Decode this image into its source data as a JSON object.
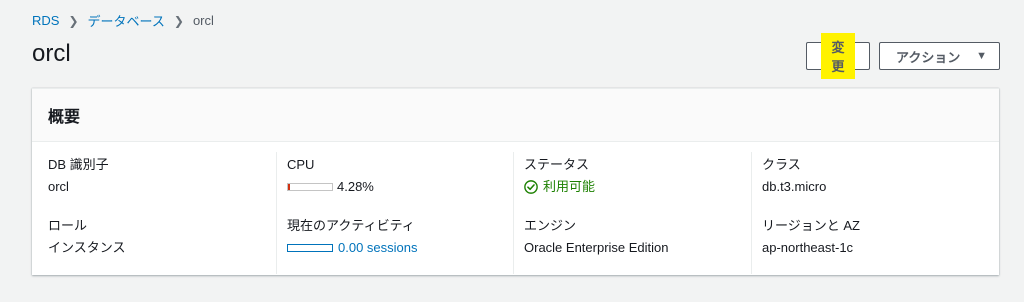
{
  "breadcrumb": {
    "root": "RDS",
    "parent": "データベース",
    "current": "orcl"
  },
  "page": {
    "title": "orcl"
  },
  "toolbar": {
    "modify_label": "変更",
    "actions_label": "アクション"
  },
  "summary": {
    "title": "概要",
    "db_identifier": {
      "label": "DB 識別子",
      "value": "orcl"
    },
    "cpu": {
      "label": "CPU",
      "value": "4.28%",
      "percent": 4.28
    },
    "status": {
      "label": "ステータス",
      "value": "利用可能"
    },
    "class": {
      "label": "クラス",
      "value": "db.t3.micro"
    },
    "role": {
      "label": "ロール",
      "value": "インスタンス"
    },
    "activity": {
      "label": "現在のアクティビティ",
      "value": "0.00 sessions"
    },
    "engine": {
      "label": "エンジン",
      "value": "Oracle Enterprise Edition"
    },
    "region": {
      "label": "リージョンと AZ",
      "value": "ap-northeast-1c"
    }
  },
  "colors": {
    "link": "#0073bb",
    "status_ok": "#1d8102",
    "highlight": "#fff200",
    "cpu_bar": "#d13212"
  }
}
